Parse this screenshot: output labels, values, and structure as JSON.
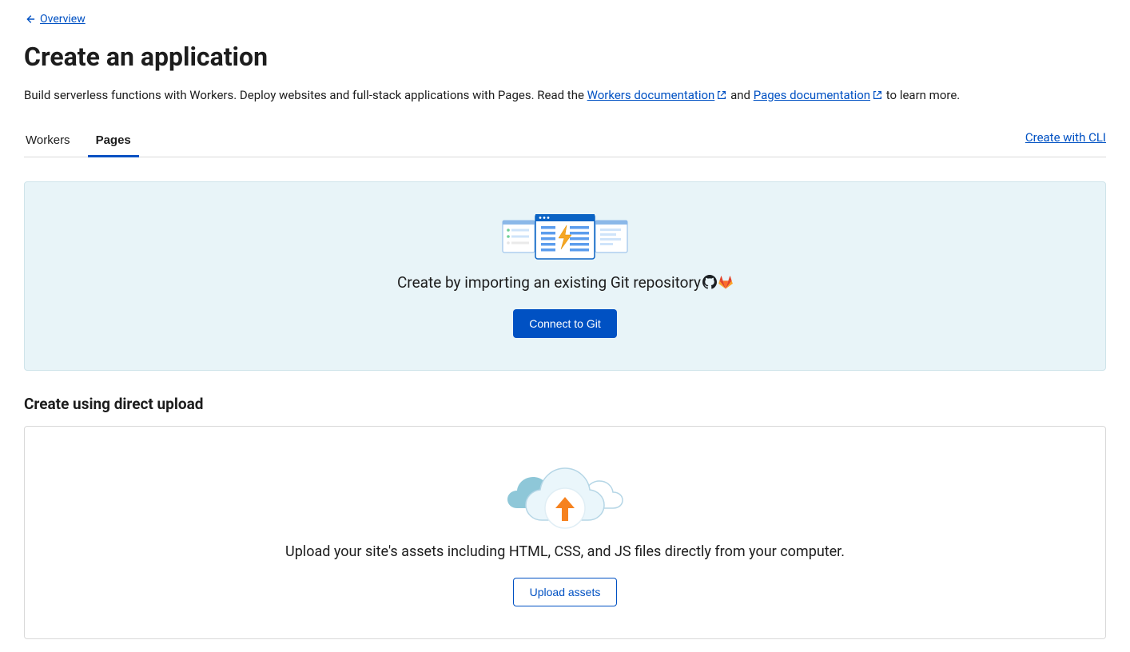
{
  "backlink": {
    "label": "Overview"
  },
  "page_title": "Create an application",
  "subtitle": {
    "before": "Build serverless functions with Workers. Deploy websites and full-stack applications with Pages. Read the ",
    "link1": "Workers documentation",
    "middle": " and ",
    "link2": "Pages documentation",
    "after": " to learn more."
  },
  "tabs": {
    "workers": "Workers",
    "pages": "Pages"
  },
  "create_cli": "Create with CLI",
  "git_card": {
    "title": "Create by importing an existing Git repository",
    "button": "Connect to Git"
  },
  "upload_section": {
    "heading": "Create using direct upload",
    "desc": "Upload your site's assets including HTML, CSS, and JS files directly from your computer.",
    "button": "Upload assets"
  }
}
